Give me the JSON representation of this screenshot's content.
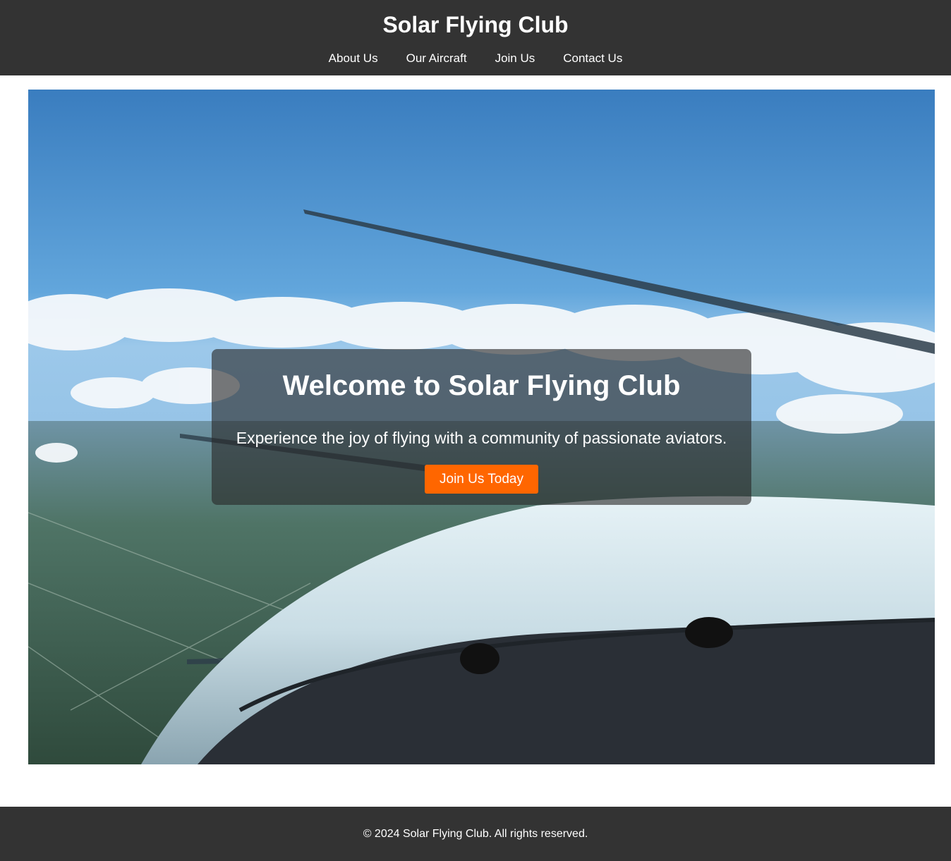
{
  "header": {
    "title": "Solar Flying Club",
    "nav": [
      {
        "label": "About Us"
      },
      {
        "label": "Our Aircraft"
      },
      {
        "label": "Join Us"
      },
      {
        "label": "Contact Us"
      }
    ]
  },
  "hero": {
    "title": "Welcome to Solar Flying Club",
    "subtitle": "Experience the joy of flying with a community of passionate aviators.",
    "cta_label": "Join Us Today"
  },
  "footer": {
    "text": "© 2024 Solar Flying Club. All rights reserved."
  },
  "colors": {
    "header_bg": "#333333",
    "cta": "#ff6600",
    "text": "#ffffff"
  }
}
